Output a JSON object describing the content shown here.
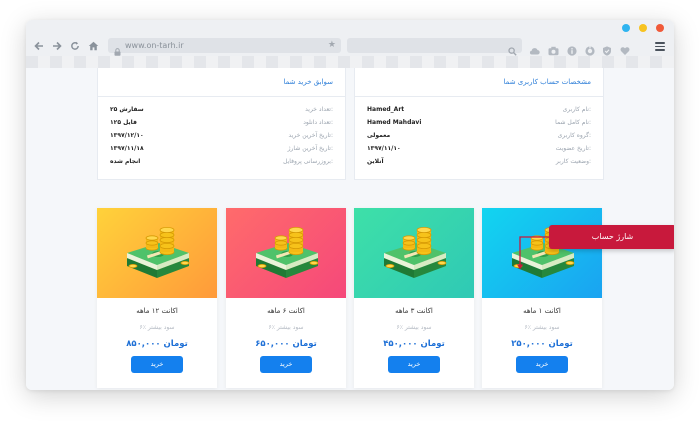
{
  "browser": {
    "url": "www.on-tarh.ir",
    "dots": [
      "#2fb4f0",
      "#f7c321",
      "#f05a3a"
    ],
    "toolbar_icons": [
      "cloud-icon",
      "camera-icon",
      "info-icon",
      "compass-icon",
      "shield-icon",
      "heart-icon",
      "menu-icon"
    ]
  },
  "account_info": {
    "title": "مشخصات حساب کاربری شما",
    "rows": [
      {
        "label": "نام کاربری:",
        "value": "Hamed_Art"
      },
      {
        "label": "نام کامل شما:",
        "value": "Hamed Mahdavi"
      },
      {
        "label": "گروه کاربری:",
        "value": "معمولی"
      },
      {
        "label": "تاریخ عضویت:",
        "value": "۱۳۹۷/۱۱/۱۰"
      },
      {
        "label": "وضعیت کاربر:",
        "value": "آنلاین"
      }
    ]
  },
  "purchase_history": {
    "title": "سوابق خرید شما",
    "rows": [
      {
        "label": "تعداد خرید:",
        "value": "۲۵ سفارش"
      },
      {
        "label": "تعداد دانلود:",
        "value": "۱۲۵ فایل"
      },
      {
        "label": "تاریخ آخرین خرید:",
        "value": "۱۳۹۷/۱۲/۱۰"
      },
      {
        "label": "تاریخ آخرین شارژ:",
        "value": "۱۳۹۷/۱۱/۱۸"
      },
      {
        "label": "بروزرسانی پروفایل:",
        "value": "انجام شده"
      }
    ]
  },
  "callout": {
    "label": "شارژ حساب",
    "color": "#c8193c"
  },
  "plans": [
    {
      "title": "اکانت ۱ ماهه",
      "subtitle": "۶٪ سود بیشتر",
      "price": "۲۵۰,۰۰۰ تومان",
      "button": "خرید",
      "gradient": [
        "#12d5f0",
        "#1aa3f1"
      ]
    },
    {
      "title": "اکانت ۳ ماهه",
      "subtitle": "۶٪ سود بیشتر",
      "price": "۴۵۰,۰۰۰ تومان",
      "button": "خرید",
      "gradient": [
        "#3ee0a8",
        "#2fc9b5"
      ]
    },
    {
      "title": "اکانت ۶ ماهه",
      "subtitle": "۶٪ سود بیشتر",
      "price": "۶۵۰,۰۰۰ تومان",
      "button": "خرید",
      "gradient": [
        "#ff6b6b",
        "#f5487a"
      ]
    },
    {
      "title": "اکانت ۱۲ ماهه",
      "subtitle": "۶٪ سود بیشتر",
      "price": "۸۵۰,۰۰۰ تومان",
      "button": "خرید",
      "gradient": [
        "#ffd23a",
        "#ff9a3a"
      ]
    }
  ]
}
